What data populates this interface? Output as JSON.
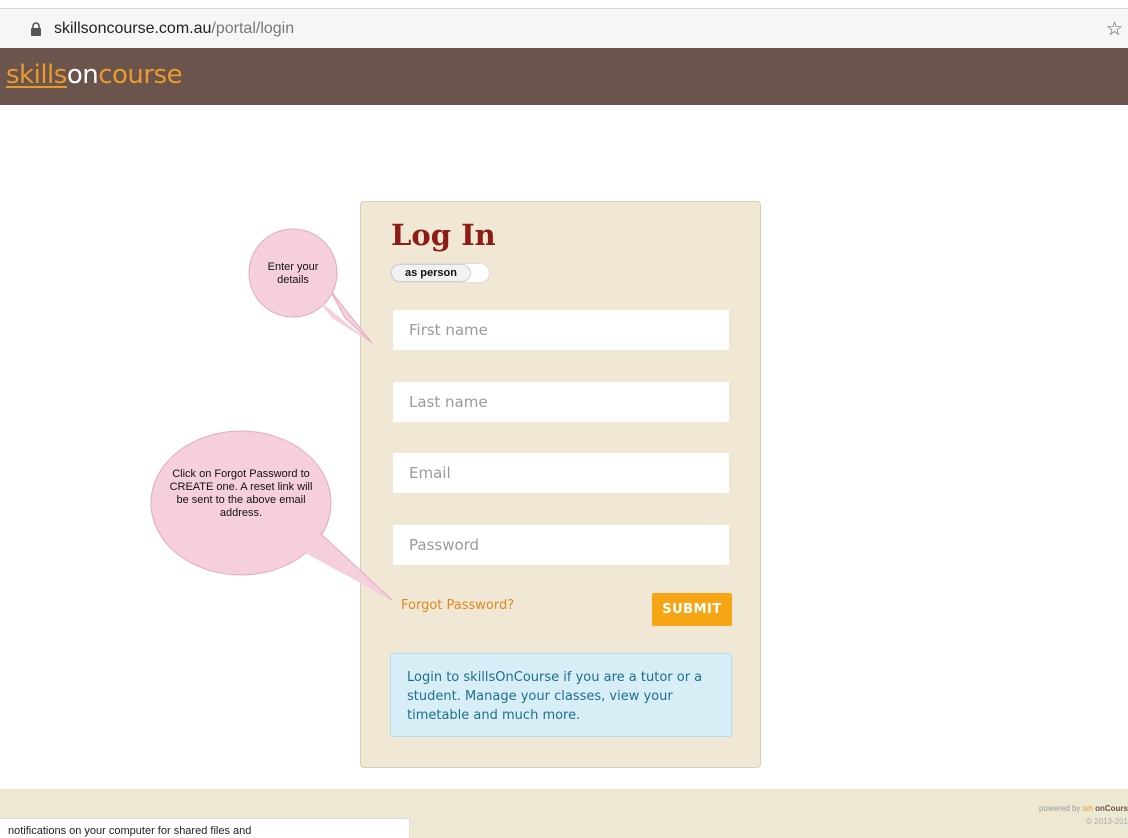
{
  "browser": {
    "url_host": "skillsoncourse.com.au",
    "url_path": "/portal/login"
  },
  "header": {
    "logo_part1": "skills",
    "logo_part2": "on",
    "logo_part3": "course"
  },
  "login": {
    "title": "Log In",
    "toggle_label": "as person",
    "first_name_placeholder": "First name",
    "last_name_placeholder": "Last name",
    "email_placeholder": "Email",
    "password_placeholder": "Password",
    "forgot_label": "Forgot Password?",
    "submit_label": "SUBMIT",
    "info_text": "Login to skillsOnCourse if you are a tutor or a student. Manage your classes, view your timetable and much more."
  },
  "annotations": {
    "bubble1_line1": "Enter your",
    "bubble1_line2": "details",
    "bubble2_line1": "Click on Forgot Password to",
    "bubble2_line2": "CREATE one. A reset link will",
    "bubble2_line3": "be sent to the above email",
    "bubble2_line4": "address."
  },
  "footer": {
    "notification_text": "notifications on your computer for shared files and",
    "powered_prefix": "powered by",
    "powered_ish": "ish",
    "powered_oncourse": "onCours",
    "copyright": "© 2013-201"
  },
  "colors": {
    "header_bg": "#6b544c",
    "brand_orange": "#e89a2d",
    "title_red": "#8e1c16",
    "submit_bg": "#f6a614",
    "card_bg": "#f0e7d4",
    "bubble_pink": "#f6cfdd"
  }
}
